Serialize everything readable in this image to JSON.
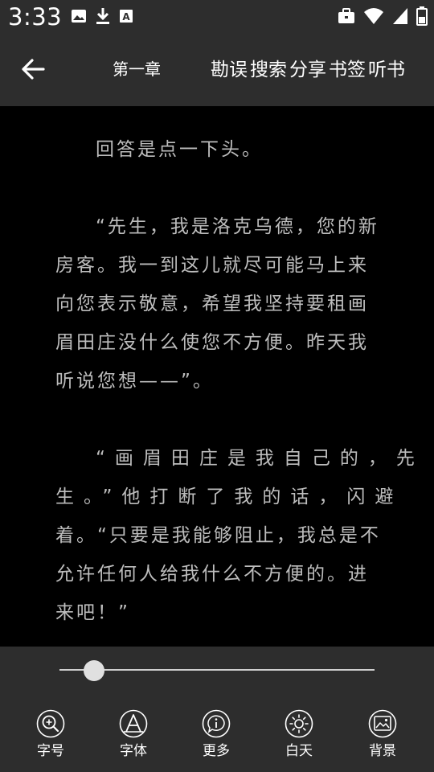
{
  "status_bar": {
    "time": "3:33",
    "left_icons": [
      "image-icon",
      "download-icon",
      "text-a-icon"
    ],
    "right_icons": [
      "briefcase-icon",
      "wifi-icon",
      "signal-icon",
      "battery-icon"
    ]
  },
  "toolbar": {
    "back_icon": "arrow-left-icon",
    "chapter_title": "第一章",
    "actions": [
      "勘误",
      "搜索",
      "分享",
      "书签",
      "听书"
    ]
  },
  "content": {
    "paragraphs": [
      [
        "回答是点一下头。"
      ],
      [
        "“先生，我是洛克乌德，您的新",
        "房客。我一到这儿就尽可能马上来",
        "向您表示敬意，希望我坚持要租画",
        "眉田庄没什么使您不方便。昨天我",
        "听说您想——”。"
      ],
      [
        "“画眉田庄是我自己的，先",
        "生。”他打断了我的话，闪避",
        "着。“只要是我能够阻止，我总是不",
        "允许任何人给我什么不方便的。进",
        "来吧！”"
      ]
    ]
  },
  "bottom_panel": {
    "progress": 0.11,
    "menu": [
      {
        "label": "字号",
        "icon": "zoom-in-icon"
      },
      {
        "label": "字体",
        "icon": "font-icon"
      },
      {
        "label": "更多",
        "icon": "info-icon"
      },
      {
        "label": "白天",
        "icon": "sun-icon"
      },
      {
        "label": "背景",
        "icon": "image-icon"
      }
    ]
  },
  "colors": {
    "bar_background": "#2d2d2d",
    "page_background": "#000000",
    "text": "#bdbdbd"
  }
}
